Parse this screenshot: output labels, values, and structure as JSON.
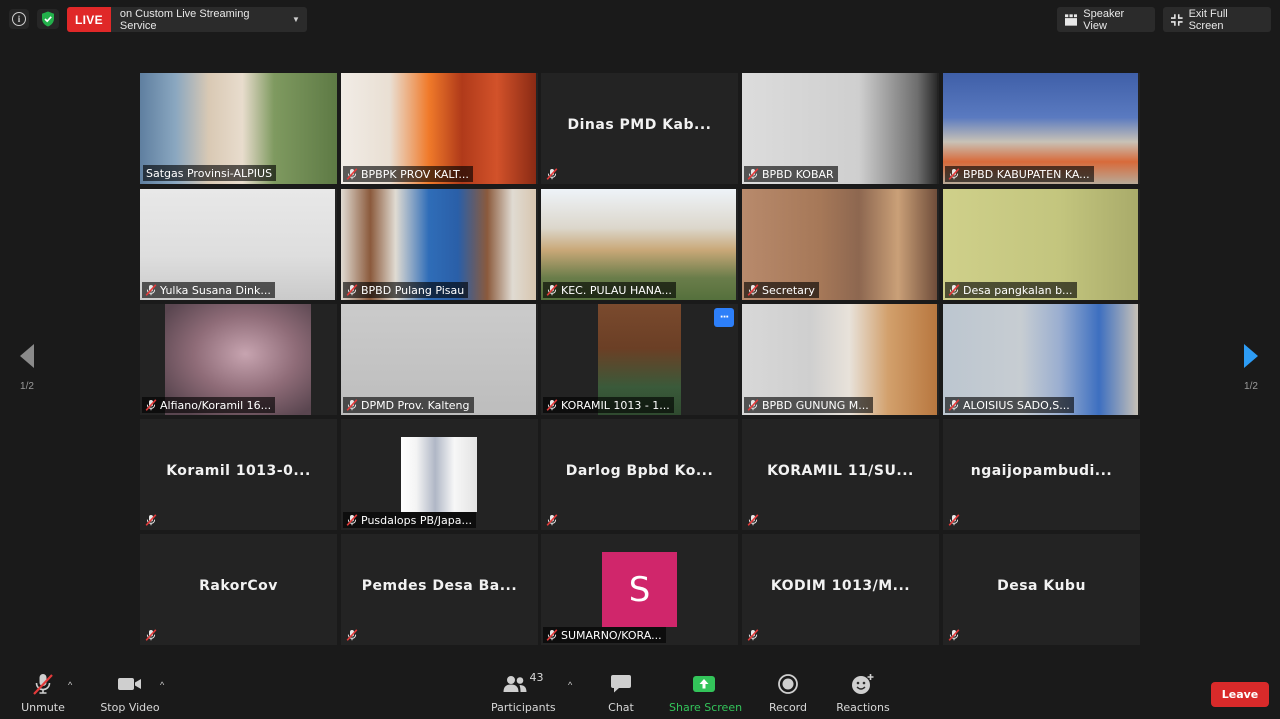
{
  "top_bar": {
    "live_label": "LIVE",
    "stream_service": "on Custom Live Streaming Service",
    "speaker_view": "Speaker View",
    "exit_full_screen": "Exit Full Screen"
  },
  "pager": {
    "left_label": "1/2",
    "right_label": "1/2"
  },
  "tiles": [
    {
      "name": "Satgas Provinsi-ALPIUS",
      "type": "video",
      "active": true
    },
    {
      "name": "BPBPK PROV KALT...",
      "type": "video"
    },
    {
      "name": "",
      "center": "Dinas PMD Kab...",
      "type": "name"
    },
    {
      "name": "BPBD KOBAR",
      "type": "video"
    },
    {
      "name": "BPBD KABUPATEN KA...",
      "type": "video"
    },
    {
      "name": "Yulka Susana Dink...",
      "type": "video"
    },
    {
      "name": "BPBD Pulang Pisau",
      "type": "video"
    },
    {
      "name": "KEC. PULAU HANA...",
      "type": "video"
    },
    {
      "name": "Secretary",
      "type": "video"
    },
    {
      "name": "Desa pangkalan b...",
      "type": "video"
    },
    {
      "name": "Alfiano/Koramil 16...",
      "type": "video"
    },
    {
      "name": "DPMD Prov. Kalteng",
      "type": "video"
    },
    {
      "name": "KORAMIL 1013 - 1...",
      "type": "video",
      "more": "···"
    },
    {
      "name": "BPBD GUNUNG M...",
      "type": "video"
    },
    {
      "name": "ALOISIUS SADO,S...",
      "type": "video"
    },
    {
      "name": "",
      "center": "Koramil 1013-0...",
      "type": "name"
    },
    {
      "name": "Pusdalops PB/Japa...",
      "type": "video"
    },
    {
      "name": "",
      "center": "Darlog Bpbd Ko...",
      "type": "name"
    },
    {
      "name": "",
      "center": "KORAMIL 11/SU...",
      "type": "name"
    },
    {
      "name": "",
      "center": "ngaijopambudi...",
      "type": "name"
    },
    {
      "name": "",
      "center": "RakorCov",
      "type": "name"
    },
    {
      "name": "",
      "center": "Pemdes Desa Ba...",
      "type": "name"
    },
    {
      "name": "SUMARNO/KORA...",
      "type": "avatar",
      "letter": "S"
    },
    {
      "name": "",
      "center": "KODIM 1013/M...",
      "type": "name"
    },
    {
      "name": "",
      "center": "Desa Kubu",
      "type": "name"
    }
  ],
  "toolbar": {
    "unmute": "Unmute",
    "stop_video": "Stop Video",
    "participants": "Participants",
    "participants_count": "43",
    "chat": "Chat",
    "share_screen": "Share Screen",
    "record": "Record",
    "reactions": "Reactions",
    "leave": "Leave"
  },
  "colors": {
    "live_red": "#e02828",
    "active_speaker": "#b7d341",
    "share_green": "#33c45a",
    "leave_red": "#d92a2a",
    "avatar_pink": "#d0266b"
  }
}
